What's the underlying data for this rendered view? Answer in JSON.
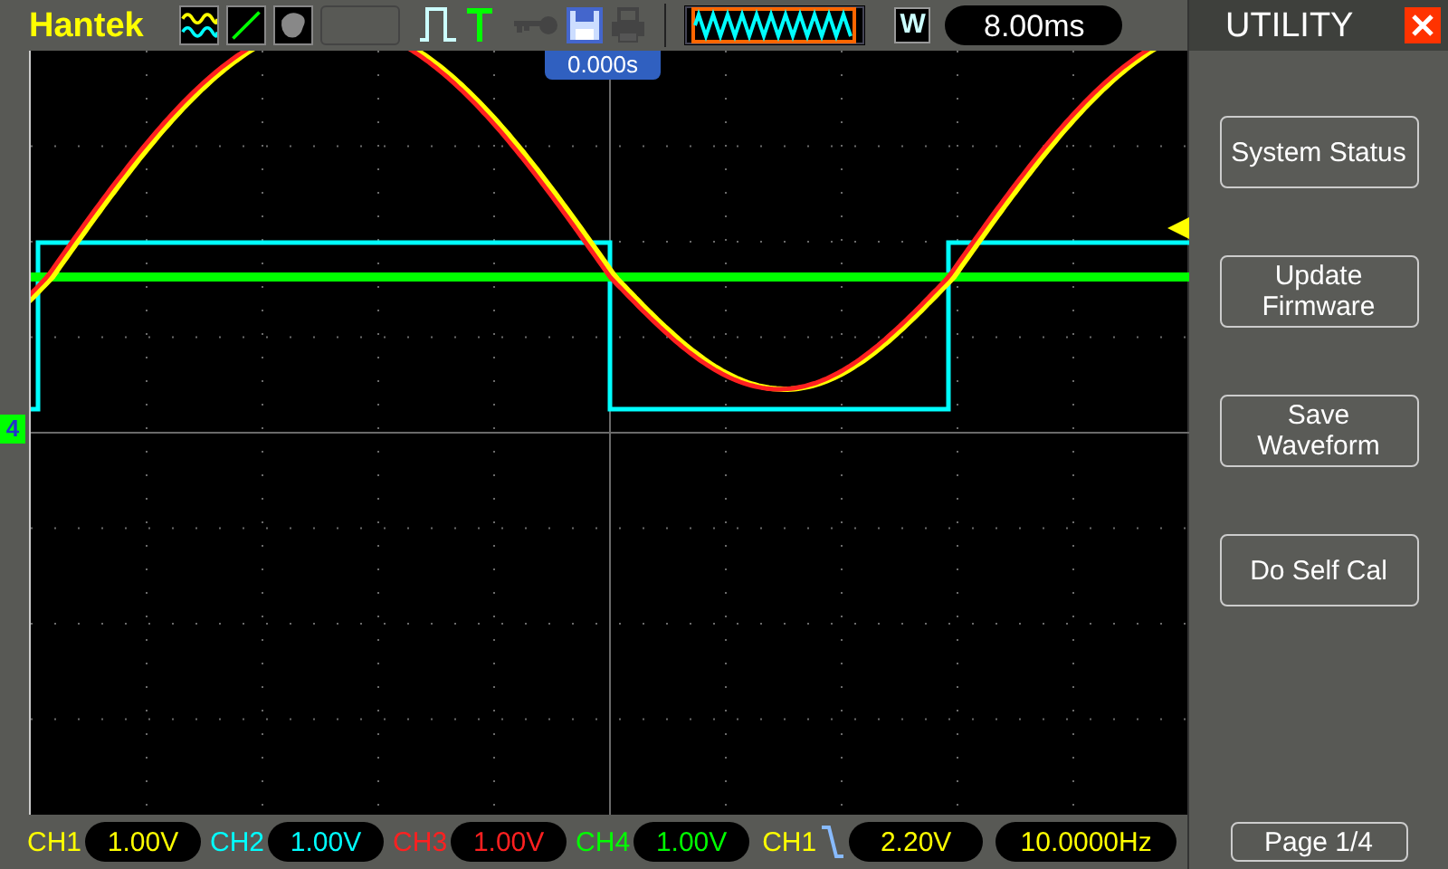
{
  "top_bar": {
    "brand": "Hantek",
    "timebase_mode": "W",
    "timebase": "8.00ms"
  },
  "screen": {
    "trigger_position": "0.000s",
    "channel_marker": "4"
  },
  "menu": {
    "title": "UTILITY",
    "items": [
      {
        "label": "System Status"
      },
      {
        "label": "Update Firmware"
      },
      {
        "label": "Save Waveform"
      },
      {
        "label": "Do Self Cal"
      }
    ],
    "page": "Page 1/4"
  },
  "channels": [
    {
      "name": "CH1",
      "scale": "1.00V",
      "color": "#ffff00"
    },
    {
      "name": "CH2",
      "scale": "1.00V",
      "color": "#00ffff"
    },
    {
      "name": "CH3",
      "scale": "1.00V",
      "color": "#ff2020"
    },
    {
      "name": "CH4",
      "scale": "1.00V",
      "color": "#00ff00"
    }
  ],
  "trigger": {
    "source": "CH1",
    "level": "2.20V",
    "frequency": "10.0000Hz"
  }
}
